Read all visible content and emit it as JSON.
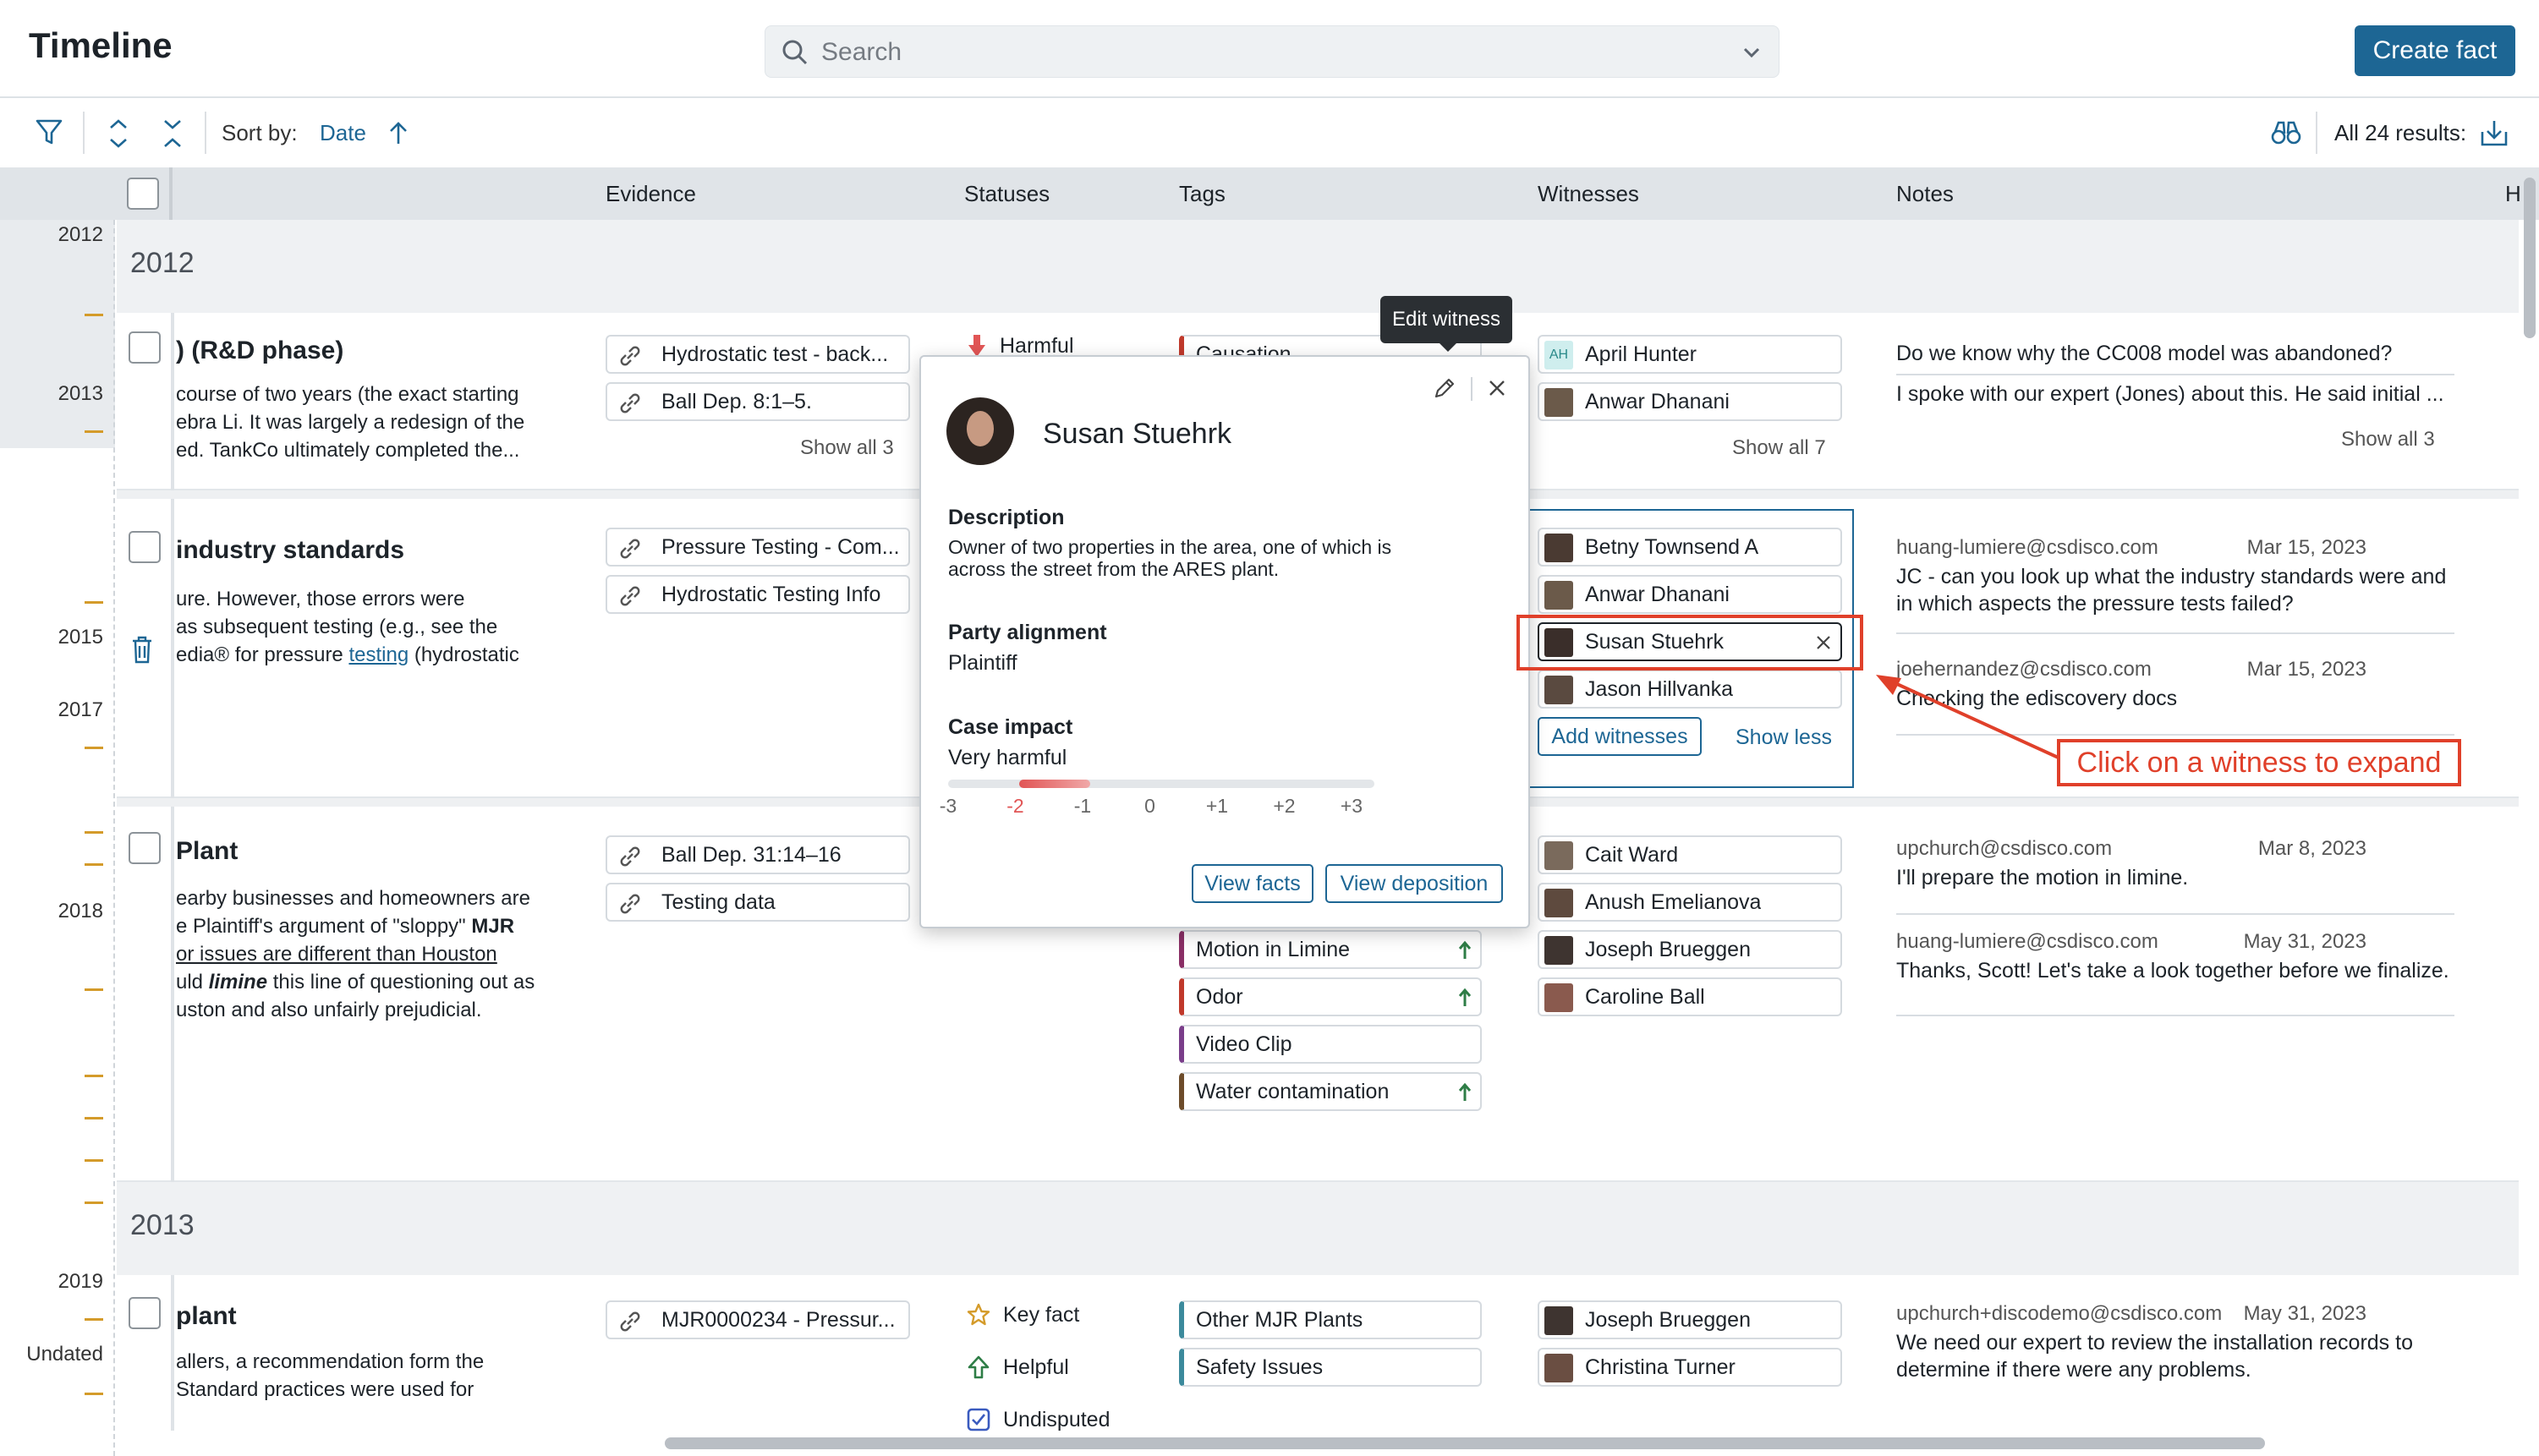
{
  "header": {
    "title": "Timeline",
    "search_placeholder": "Search",
    "create_button": "Create fact"
  },
  "toolbar": {
    "sort_label": "Sort by:",
    "sort_value": "Date",
    "results": "All 24 results:"
  },
  "columns": {
    "evidence": "Evidence",
    "statuses": "Statuses",
    "tags": "Tags",
    "witnesses": "Witnesses",
    "notes": "Notes",
    "h": "H"
  },
  "gutter_years": [
    "2012",
    "2013",
    "2015",
    "2017",
    "2018",
    "2019",
    "Undated"
  ],
  "groups": [
    {
      "year": "2012"
    },
    {
      "year": "2013"
    }
  ],
  "rows": [
    {
      "title": ") (R&D phase)",
      "desc": [
        " course of two years (the exact starting",
        "ebra Li.  It was largely a redesign of the",
        "ed.  TankCo ultimately completed the..."
      ],
      "evidence": [
        "Hydrostatic test - back...",
        "Ball Dep. 8:1–5."
      ],
      "evidence_more": "Show all 3",
      "status": "Harmful",
      "tag": "Causation",
      "witnesses": [
        "April Hunter",
        "Anwar Dhanani"
      ],
      "witness_initials": "AH",
      "witness_more": "Show all 7",
      "notes": [
        "Do we know why the CC008 model was abandoned?",
        "I spoke with our expert (Jones) about this. He said initial ..."
      ],
      "notes_more": "Show all 3"
    },
    {
      "title": " industry standards",
      "desc": [
        "ure.  However, those errors were",
        " as subsequent testing (e.g., see the",
        "edia® for pressure ",
        "testing",
        " (hydrostatic"
      ],
      "evidence": [
        "Pressure Testing - Com...",
        "Hydrostatic Testing Info"
      ],
      "witnesses": [
        "Betny Townsend A",
        "Anwar Dhanani",
        "Susan Stuehrk",
        "Jason Hillvanka"
      ],
      "add_witnesses": "Add witnesses",
      "show_less": "Show less",
      "notes": [
        {
          "email": "huang-lumiere@csdisco.com",
          "date": "Mar 15, 2023",
          "text": [
            "JC - can you look up what the industry standards were and",
            "in which aspects the pressure tests failed?"
          ]
        },
        {
          "email": "joehernandez@csdisco.com",
          "date": "Mar 15, 2023",
          "text": [
            "Checking the ediscovery docs"
          ]
        }
      ]
    },
    {
      "title": " Plant",
      "desc_a": [
        "earby businesses and homeowners are",
        "e Plaintiff's argument of \"sloppy\" "
      ],
      "desc_a_bold": "MJR",
      "desc_b": "or issues are different than Houston ",
      "desc_c_pre": "uld ",
      "desc_c_em": "limine",
      "desc_c_post": " this line of questioning out as",
      "desc_d": "uston and also unfairly prejudicial.",
      "evidence": [
        "Ball Dep. 31:14–16",
        "Testing data"
      ],
      "tags": [
        "Motion in Limine",
        "Odor",
        "Video Clip",
        "Water contamination"
      ],
      "witnesses": [
        "Cait Ward",
        "Anush Emelianova",
        "Joseph Brueggen",
        "Caroline Ball"
      ],
      "notes": [
        {
          "email": "upchurch@csdisco.com",
          "date": "Mar 8, 2023",
          "text": [
            "I'll prepare the motion in limine."
          ]
        },
        {
          "email": "huang-lumiere@csdisco.com",
          "date": "May 31, 2023",
          "text": [
            "Thanks, Scott! Let's take a look together before we finalize."
          ]
        }
      ]
    },
    {
      "title": " plant",
      "desc": [
        "allers, a recommendation form the",
        "Standard practices were used for"
      ],
      "evidence": [
        "MJR0000234 - Pressur..."
      ],
      "statuses": [
        "Key fact",
        "Helpful",
        "Undisputed"
      ],
      "tags": [
        "Other MJR Plants",
        "Safety Issues"
      ],
      "witnesses": [
        "Joseph Brueggen",
        "Christina Turner"
      ],
      "notes": [
        {
          "email": "upchurch+discodemo@csdisco.com",
          "date": "May 31, 2023",
          "text": [
            "We need our expert to review the installation records to",
            "determine if there were any problems."
          ]
        }
      ]
    }
  ],
  "popup": {
    "name": "Susan Stuehrk",
    "tooltip": "Edit witness",
    "description_label": "Description",
    "description": [
      "Owner of two properties in the area, one of which is",
      "across the street from the ARES plant."
    ],
    "alignment_label": "Party alignment",
    "alignment": "Plaintiff",
    "impact_label": "Case impact",
    "impact": "Very harmful",
    "impact_value": -2,
    "scale": [
      "-3",
      "-2",
      "-1",
      "0",
      "+1",
      "+2",
      "+3"
    ],
    "view_facts": "View facts",
    "view_deposition": "View deposition"
  },
  "annotation": {
    "label": "Click on a witness to expand",
    "color": "#e0402a"
  },
  "colors": {
    "accent": "#1d6694",
    "timeline_tick": "#d49b2a",
    "harmful": "#e15555",
    "helpful": "#2e7d46"
  }
}
